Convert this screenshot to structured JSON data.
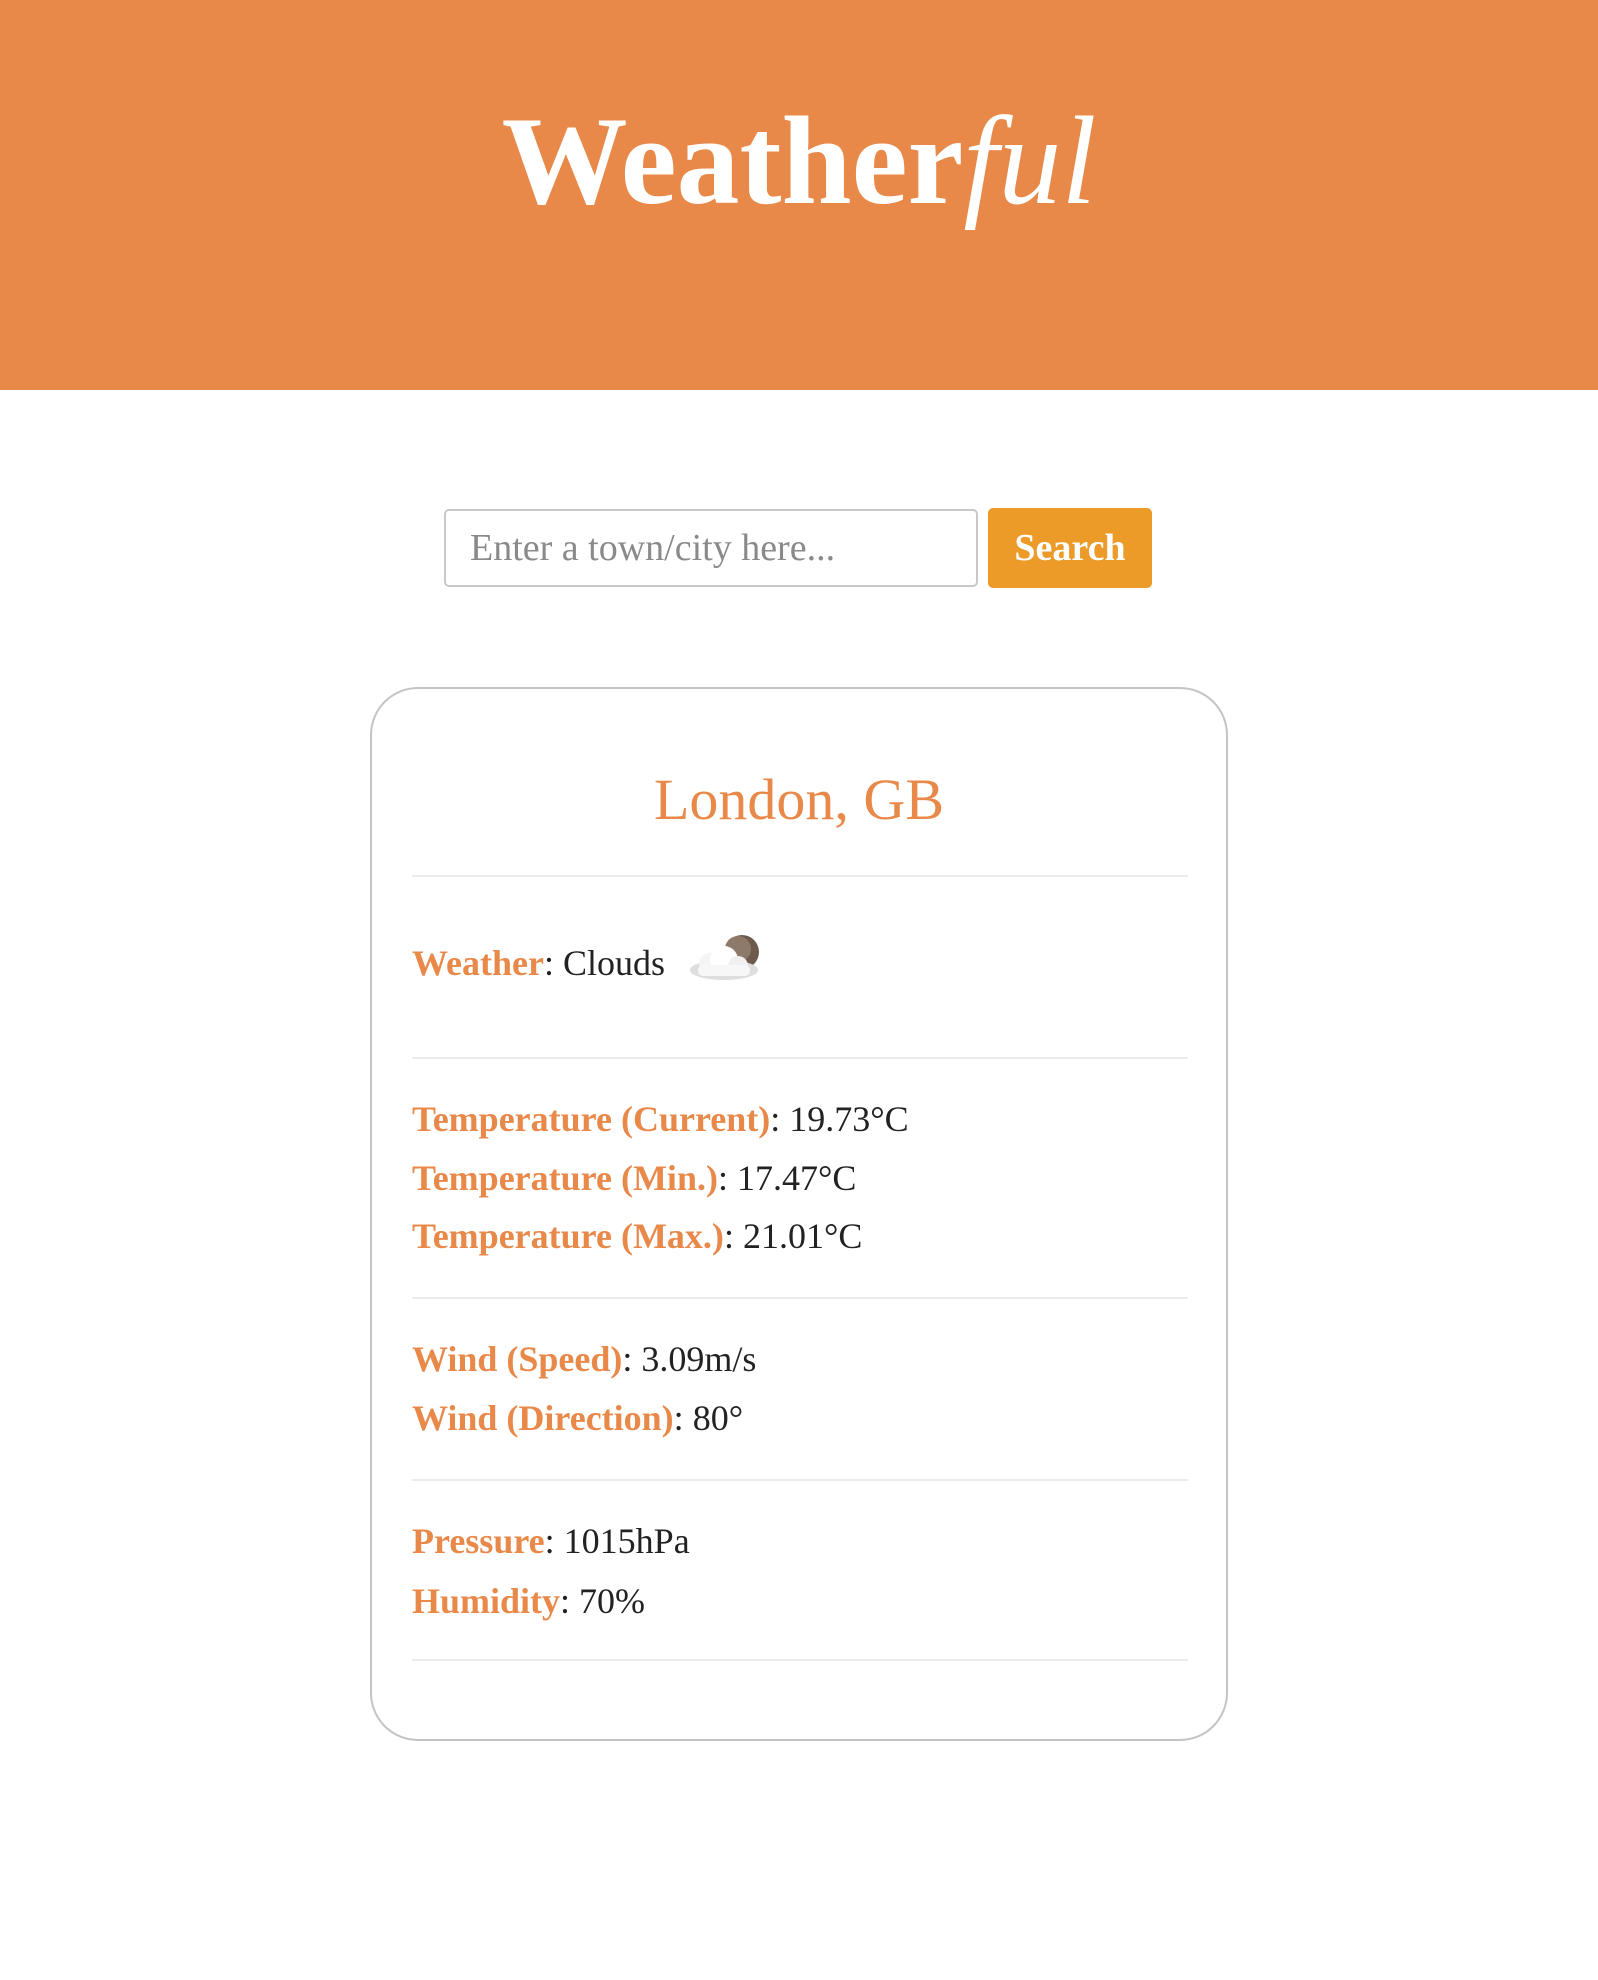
{
  "app": {
    "title_main": "Weather",
    "title_suffix": "ful"
  },
  "search": {
    "placeholder": "Enter a town/city here...",
    "value": "",
    "button_label": "Search"
  },
  "colors": {
    "header": "#e8894a",
    "accent": "#e8894a",
    "button": "#ec9a28"
  },
  "result": {
    "location": "London, GB",
    "weather": {
      "label": "Weather",
      "separator": ": ",
      "value": "Clouds",
      "icon": "cloud-icon"
    },
    "temperature": [
      {
        "label": "Temperature (Current)",
        "separator": ": ",
        "value": "19.73°C"
      },
      {
        "label": "Temperature (Min.)",
        "separator": ": ",
        "value": "17.47°C"
      },
      {
        "label": "Temperature (Max.)",
        "separator": ": ",
        "value": "21.01°C"
      }
    ],
    "wind": [
      {
        "label": "Wind (Speed)",
        "separator": ": ",
        "value": "3.09m/s"
      },
      {
        "label": "Wind (Direction)",
        "separator": ": ",
        "value": "80°"
      }
    ],
    "atmosphere": [
      {
        "label": "Pressure",
        "separator": ": ",
        "value": "1015hPa"
      },
      {
        "label": "Humidity",
        "separator": ": ",
        "value": "70%"
      }
    ]
  }
}
